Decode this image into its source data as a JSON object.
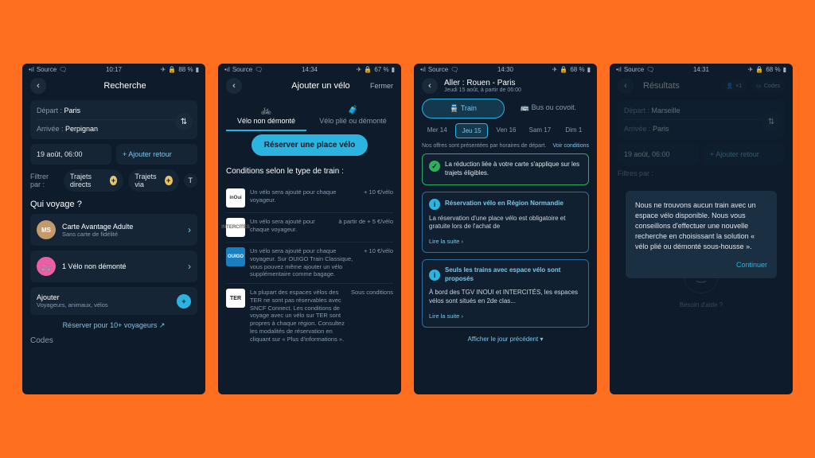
{
  "screens": [
    {
      "status": {
        "source": "Source",
        "time": "10:17",
        "battery": "88 %"
      },
      "title": "Recherche",
      "from_label": "Départ :",
      "from": "Paris",
      "to_label": "Arrivée :",
      "to": "Perpignan",
      "date": "19 août, 06:00",
      "add_return": "+ Ajouter retour",
      "filter_label": "Filtrer par :",
      "filter_direct": "Trajets directs",
      "filter_via": "Trajets via",
      "who_title": "Qui voyage ?",
      "avatar": "MS",
      "card_name": "Carte Avantage Adulte",
      "card_sub": "Sans carte de fidélité",
      "bike_line": "1 Vélo non démonté",
      "add_title": "Ajouter",
      "add_sub": "Voyageurs, animaux, vélos",
      "link10": "Réserver pour 10+ voyageurs",
      "codes": "Codes"
    },
    {
      "status": {
        "source": "Source",
        "time": "14:34",
        "battery": "67 %"
      },
      "title": "Ajouter un vélo",
      "close": "Fermer",
      "tab1": "Vélo non démonté",
      "tab2": "Vélo plié ou démonté",
      "cta": "Réserver une place vélo",
      "cond_title": "Conditions selon le type de train :",
      "trains": [
        {
          "brand": "inOui",
          "cls": "",
          "text": "Un vélo sera ajouté pour chaque voyageur.",
          "price": "+ 10 €/vélo"
        },
        {
          "brand": "INTERCITÉS",
          "cls": "inter",
          "text": "Un vélo sera ajouté pour chaque voyageur.",
          "price": "à partir de + 5 €/vélo"
        },
        {
          "brand": "OUIGO",
          "cls": "ouigo",
          "text": "Un vélo sera ajouté pour chaque voyageur. Sur OUIGO Train Classique, vous pouvez même ajouter un vélo supplémentaire comme bagage.",
          "price": "+ 10 €/vélo"
        },
        {
          "brand": "TER",
          "cls": "ter",
          "text": "La plupart des espaces vélos des TER ne sont pas réservables avec SNCF Connect. Les conditions de voyage avec un vélo sur TER sont propres à chaque région. Consultez les modalités de réservation en cliquant sur « Plus d'informations ».",
          "price": "Sous conditions"
        }
      ]
    },
    {
      "status": {
        "source": "Source",
        "time": "14:30",
        "battery": "68 %"
      },
      "journey": "Aller : Rouen - Paris",
      "journey_sub": "Jeudi 15 août, à partir de 06:00",
      "mode_train": "Train",
      "mode_bus": "Bus ou covoit.",
      "dates": [
        "Mer 14",
        "Jeu 15",
        "Ven 16",
        "Sam 17",
        "Dim 1"
      ],
      "offers_note": "Nos offres sont présentées par horaires de départ.",
      "see_cond": "Voir conditions",
      "green": "La réduction liée à votre carte s'applique sur les trajets éligibles.",
      "blue1_title": "Réservation vélo en Région Normandie",
      "blue1_body": "La réservation d'une place vélo est obligatoire et gratuite lors de l'achat de",
      "blue2_title": "Seuls les trains avec espace vélo sont proposés",
      "blue2_body": "À bord des TGV INOUI et INTERCITÉS, les espaces vélos sont situés en 2de clas...",
      "read_more": "Lire la suite",
      "prev_day": "Afficher le jour précédent"
    },
    {
      "status": {
        "source": "Source",
        "time": "14:31",
        "battery": "68 %"
      },
      "title": "Résultats",
      "pax": "×1",
      "codes": "Codes",
      "from_label": "Départ :",
      "from": "Marseille",
      "to_label": "Arrivée :",
      "to": "Paris",
      "date": "19 août, 06:00",
      "add_return": "+ Ajouter retour",
      "filter_label": "Filtres par :",
      "modal": "Nous ne trouvons aucun train avec un espace vélo disponible. Nous vous conseillons d'effectuer une nouvelle recherche en choisissant la solution « vélo plié ou démonté sous-housse ».",
      "continue": "Continuer",
      "help": "Besoin d'aide ?"
    }
  ]
}
